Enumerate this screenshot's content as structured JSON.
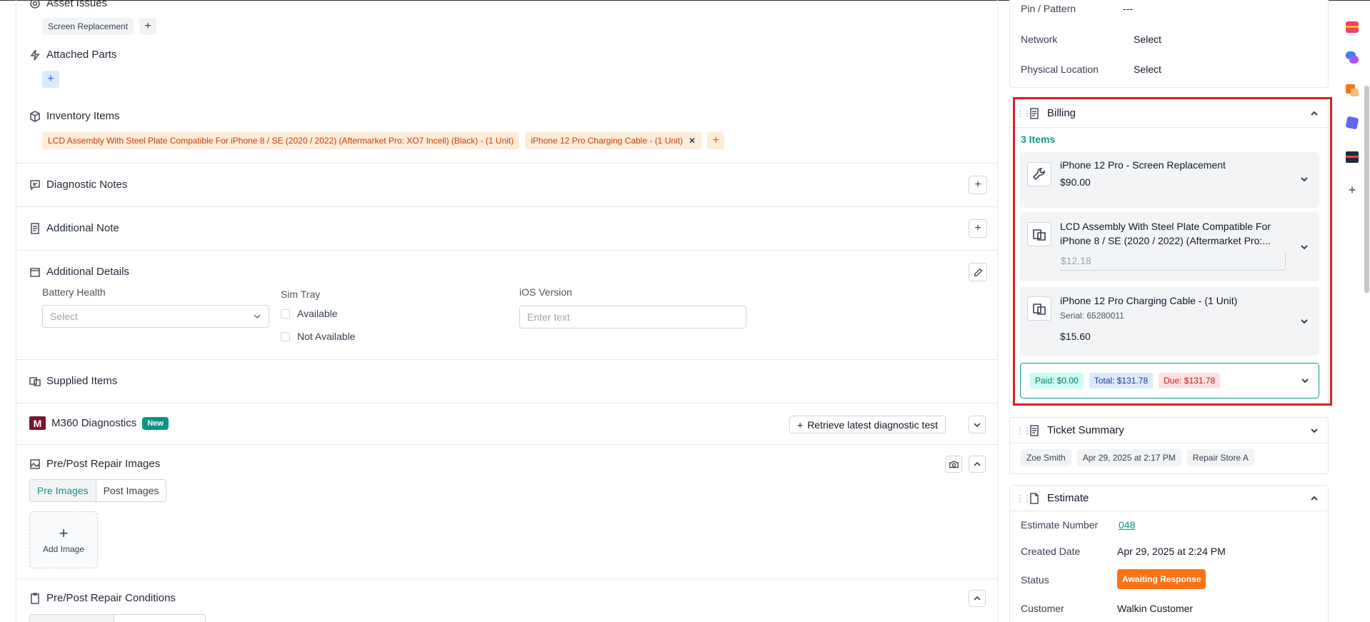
{
  "asset_issues": {
    "title": "Asset Issues",
    "chips": [
      "Screen Replacement"
    ]
  },
  "attached_parts": {
    "title": "Attached Parts"
  },
  "inventory_items": {
    "title": "Inventory Items",
    "chips": [
      "LCD Assembly With Steel Plate Compatible For iPhone 8 / SE (2020 / 2022) (Aftermarket Pro: XO7 Incell) (Black) - (1 Unit)",
      "iPhone 12 Pro Charging Cable - (1 Unit)"
    ],
    "remove_glyph": "✕"
  },
  "diagnostic_notes": {
    "title": "Diagnostic Notes"
  },
  "additional_note": {
    "title": "Additional Note"
  },
  "additional_details": {
    "title": "Additional Details",
    "battery_health_label": "Battery Health",
    "battery_health_placeholder": "Select",
    "sim_tray_label": "Sim Tray",
    "sim_options": [
      "Available",
      "Not Available"
    ],
    "ios_label": "iOS Version",
    "ios_placeholder": "Enter text"
  },
  "supplied_items": {
    "title": "Supplied Items"
  },
  "m360": {
    "logo": "M",
    "title": "M360 Diagnostics",
    "badge": "New",
    "retrieve_label": "Retrieve latest diagnostic test"
  },
  "repair_images": {
    "title": "Pre/Post Repair Images",
    "tabs": [
      "Pre Images",
      "Post Images"
    ],
    "add_label": "Add Image"
  },
  "repair_conditions": {
    "title": "Pre/Post Repair Conditions"
  },
  "device_info": {
    "rows": [
      {
        "label": "Pin / Pattern",
        "value": "---"
      },
      {
        "label": "Network",
        "value": "Select"
      },
      {
        "label": "Physical Location",
        "value": "Select"
      }
    ]
  },
  "billing": {
    "title": "Billing",
    "count": "3 Items",
    "items": [
      {
        "name": "iPhone 12 Pro - Screen Replacement",
        "price": "$90.00"
      },
      {
        "name_line1": "LCD Assembly With Steel Plate Compatible For",
        "name_line2": "iPhone 8 / SE (2020 / 2022) (Aftermarket Pro:...",
        "price": "$12.18"
      },
      {
        "name": "iPhone 12 Pro Charging Cable - (1 Unit)",
        "serial": "Serial: 65280011",
        "price": "$15.60"
      }
    ],
    "paid": "Paid: $0.00",
    "total": "Total: $131.78",
    "due": "Due: $131.78"
  },
  "ticket_summary": {
    "title": "Ticket Summary",
    "chips": [
      "Zoe Smith",
      "Apr 29, 2025 at 2:17 PM",
      "Repair Store A"
    ]
  },
  "estimate": {
    "title": "Estimate",
    "number_label": "Estimate Number",
    "number": "048",
    "created_label": "Created Date",
    "created": "Apr 29, 2025 at 2:24 PM",
    "status_label": "Status",
    "status": "Awaiting Response",
    "customer_label": "Customer",
    "customer": "Walkin Customer"
  },
  "colors": {
    "accent": "#0d9488",
    "highlight": "#e11d2a",
    "status": "#f97316"
  }
}
